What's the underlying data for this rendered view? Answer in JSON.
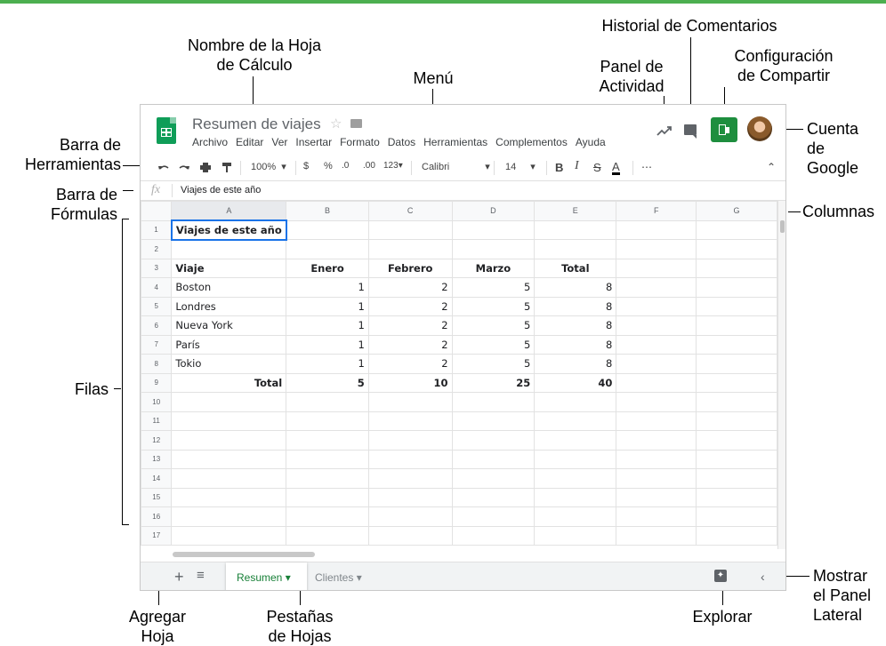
{
  "annotations": {
    "nombre_hoja": "Nombre de la Hoja\nde Cálculo",
    "menu": "Menú",
    "historial": "Historial de Comentarios",
    "panel_actividad": "Panel de\nActividad",
    "config_compartir": "Configuración\nde Compartir",
    "cuenta": "Cuenta\nde\nGoogle",
    "barra_herramientas": "Barra de\nHerramientas",
    "barra_formulas": "Barra de\nFórmulas",
    "columnas": "Columnas",
    "filas": "Filas",
    "agregar_hoja": "Agregar\nHoja",
    "pestanas": "Pestañas\nde Hojas",
    "explorar": "Explorar",
    "mostrar_panel": "Mostrar\nel Panel\nLateral"
  },
  "app": {
    "title": "Resumen de viajes",
    "menu": [
      "Archivo",
      "Editar",
      "Ver",
      "Insertar",
      "Formato",
      "Datos",
      "Herramientas",
      "Complementos",
      "Ayuda"
    ]
  },
  "toolbar": {
    "zoom": "100%",
    "currency": "$",
    "percent": "%",
    "dec_less": ".0",
    "dec_more": ".00",
    "format": "123",
    "font": "Calibri",
    "size": "14",
    "bold": "B",
    "italic": "I",
    "strike": "S",
    "text_color": "A",
    "more": "⋯"
  },
  "formula_bar": {
    "fx": "fx",
    "value": "Viajes de este año"
  },
  "grid": {
    "columns": [
      "A",
      "B",
      "C",
      "D",
      "E",
      "F",
      "G"
    ],
    "rows": [
      [
        "Viajes de este año",
        "",
        "",
        "",
        "",
        "",
        ""
      ],
      [
        "",
        "",
        "",
        "",
        "",
        "",
        ""
      ],
      [
        "Viaje",
        "Enero",
        "Febrero",
        "Marzo",
        "Total",
        "",
        ""
      ],
      [
        "Boston",
        "1",
        "2",
        "5",
        "8",
        "",
        ""
      ],
      [
        "Londres",
        "1",
        "2",
        "5",
        "8",
        "",
        ""
      ],
      [
        "Nueva York",
        "1",
        "2",
        "5",
        "8",
        "",
        ""
      ],
      [
        "París",
        "1",
        "2",
        "5",
        "8",
        "",
        ""
      ],
      [
        "Tokio",
        "1",
        "2",
        "5",
        "8",
        "",
        ""
      ],
      [
        "Total",
        "5",
        "10",
        "25",
        "40",
        "",
        ""
      ],
      [
        "",
        "",
        "",
        "",
        "",
        "",
        ""
      ],
      [
        "",
        "",
        "",
        "",
        "",
        "",
        ""
      ],
      [
        "",
        "",
        "",
        "",
        "",
        "",
        ""
      ],
      [
        "",
        "",
        "",
        "",
        "",
        "",
        ""
      ],
      [
        "",
        "",
        "",
        "",
        "",
        "",
        ""
      ],
      [
        "",
        "",
        "",
        "",
        "",
        "",
        ""
      ],
      [
        "",
        "",
        "",
        "",
        "",
        "",
        ""
      ],
      [
        "",
        "",
        "",
        "",
        "",
        "",
        ""
      ]
    ]
  },
  "sheets": {
    "add": "+",
    "list": "≡",
    "active": "Resumen",
    "other": "Clientes",
    "caret": "▾",
    "side": "‹"
  }
}
